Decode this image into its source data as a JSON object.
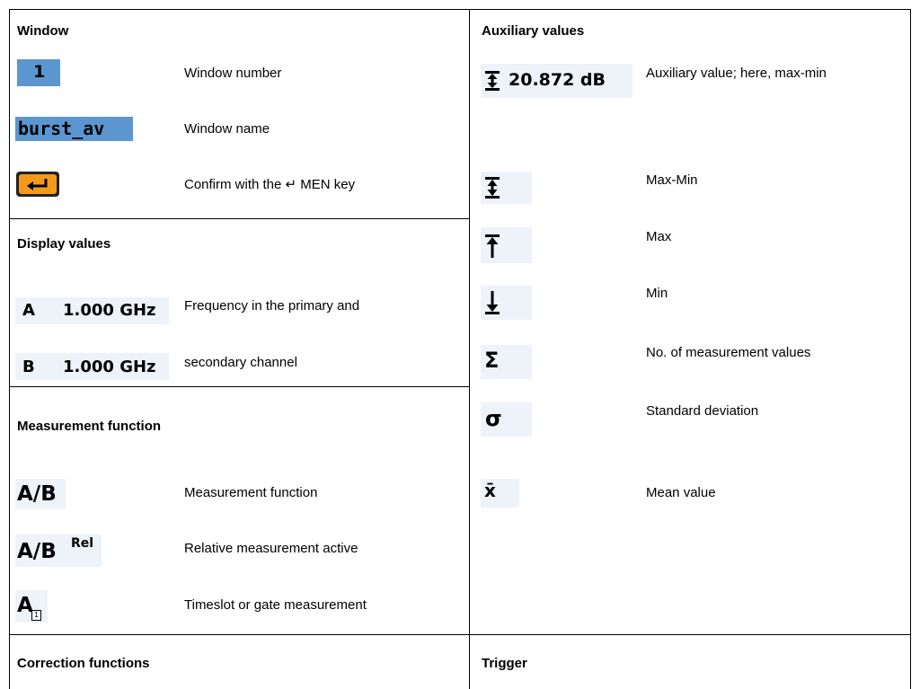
{
  "sections": {
    "window": {
      "header": "Window",
      "rows": [
        {
          "icon_text": "1",
          "desc": "Window number"
        },
        {
          "icon_text": "burst_av",
          "desc": "Window name"
        },
        {
          "desc": "Confirm with the ↵ MEN key"
        }
      ]
    },
    "display": {
      "header": "Display values",
      "rows": [
        {
          "ch": "A",
          "value": "1.000 GHz",
          "desc": "Frequency in the primary and"
        },
        {
          "ch": "B",
          "value": "1.000 GHz",
          "desc": "secondary channel"
        }
      ]
    },
    "measurement": {
      "header": "Measurement function",
      "rows": [
        {
          "icon_text": "A/B",
          "desc": "Measurement function"
        },
        {
          "icon_text": "A/B",
          "sup": "Rel",
          "desc": "Relative measurement active"
        },
        {
          "icon_text": "A",
          "sub": "1",
          "desc": "Timeslot or gate measurement"
        }
      ]
    },
    "correction": {
      "header": "Correction functions"
    },
    "auxiliary": {
      "header": "Auxiliary values",
      "rows": [
        {
          "icon": "max-min-icon",
          "value": "20.872 dB",
          "desc": "Auxiliary value; here, max-min"
        },
        {
          "icon": "max-min-icon",
          "desc": "Max-Min"
        },
        {
          "icon": "max-icon",
          "desc": "Max"
        },
        {
          "icon": "min-icon",
          "desc": "Min"
        },
        {
          "icon": "sigma-sum-icon",
          "glyph": "Σ",
          "desc": "No. of measurement values"
        },
        {
          "icon": "std-dev-icon",
          "glyph": "σ",
          "desc": "Standard deviation"
        },
        {
          "icon": "mean-icon",
          "glyph": "x̄",
          "desc": "Mean value"
        }
      ]
    },
    "trigger": {
      "header": "Trigger"
    }
  }
}
